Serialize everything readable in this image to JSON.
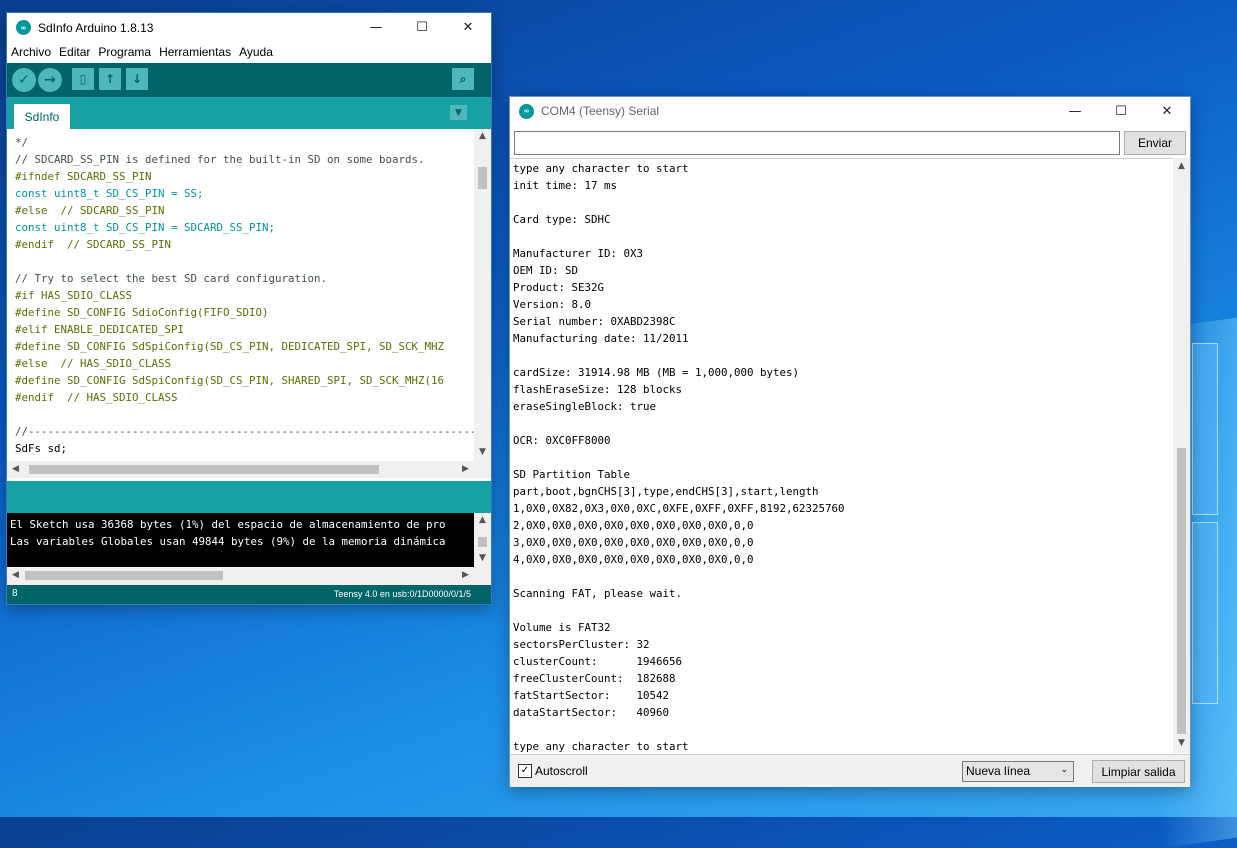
{
  "colors": {
    "arduino_dark": "#006468",
    "arduino_teal": "#17a1a5",
    "arduino_button": "#4db7bb",
    "console_bg": "#000000"
  },
  "ide": {
    "title": "SdInfo Arduino 1.8.13",
    "logo": "arduino-logo-icon",
    "menu": [
      "Archivo",
      "Editar",
      "Programa",
      "Herramientas",
      "Ayuda"
    ],
    "toolbar": {
      "verify": "verify-icon",
      "upload": "upload-icon",
      "new": "new-icon",
      "open": "open-icon",
      "save": "save-icon",
      "serial_monitor": "serial-monitor-icon"
    },
    "tab": "SdInfo",
    "code_lines": [
      {
        "text": "*/",
        "cls": "cm"
      },
      {
        "text": "// SDCARD_SS_PIN is defined for the built-in SD on some boards.",
        "cls": "cm"
      },
      {
        "text": "#ifndef SDCARD_SS_PIN",
        "cls": "kw"
      },
      {
        "text": "const uint8_t SD_CS_PIN = SS;",
        "cls": "ty"
      },
      {
        "text": "#else  // SDCARD_SS_PIN",
        "cls": "kw"
      },
      {
        "text": "const uint8_t SD_CS_PIN = SDCARD_SS_PIN;",
        "cls": "ty"
      },
      {
        "text": "#endif  // SDCARD_SS_PIN",
        "cls": "kw"
      },
      {
        "text": "",
        "cls": ""
      },
      {
        "text": "// Try to select the best SD card configuration.",
        "cls": "cm"
      },
      {
        "text": "#if HAS_SDIO_CLASS",
        "cls": "kw"
      },
      {
        "text": "#define SD_CONFIG SdioConfig(FIFO_SDIO)",
        "cls": "kw"
      },
      {
        "text": "#elif ENABLE_DEDICATED_SPI",
        "cls": "kw"
      },
      {
        "text": "#define SD_CONFIG SdSpiConfig(SD_CS_PIN, DEDICATED_SPI, SD_SCK_MHZ",
        "cls": "kw"
      },
      {
        "text": "#else  // HAS_SDIO_CLASS",
        "cls": "kw"
      },
      {
        "text": "#define SD_CONFIG SdSpiConfig(SD_CS_PIN, SHARED_SPI, SD_SCK_MHZ(16",
        "cls": "kw"
      },
      {
        "text": "#endif  // HAS_SDIO_CLASS",
        "cls": "kw"
      },
      {
        "text": "",
        "cls": ""
      },
      {
        "text": "//------------------------------------------------------------------------------",
        "cls": "cm"
      },
      {
        "text": "SdFs sd;",
        "cls": ""
      }
    ],
    "console_lines": [
      "El Sketch usa 36368 bytes (1%) del espacio de almacenamiento de pro",
      "Las variables Globales usan 49844 bytes (9%) de la memoria dinámica"
    ],
    "status_line": "8",
    "status_board": "Teensy 4.0 en usb:0/1D0000/0/1/5"
  },
  "serial": {
    "title": "COM4 (Teensy) Serial",
    "send_value": "",
    "send_label": "Enviar",
    "output_lines": [
      "type any character to start",
      "init time: 17 ms",
      "",
      "Card type: SDHC",
      "",
      "Manufacturer ID: 0X3",
      "OEM ID: SD",
      "Product: SE32G",
      "Version: 8.0",
      "Serial number: 0XABD2398C",
      "Manufacturing date: 11/2011",
      "",
      "cardSize: 31914.98 MB (MB = 1,000,000 bytes)",
      "flashEraseSize: 128 blocks",
      "eraseSingleBlock: true",
      "",
      "OCR: 0XC0FF8000",
      "",
      "SD Partition Table",
      "part,boot,bgnCHS[3],type,endCHS[3],start,length",
      "1,0X0,0X82,0X3,0X0,0XC,0XFE,0XFF,0XFF,8192,62325760",
      "2,0X0,0X0,0X0,0X0,0X0,0X0,0X0,0X0,0,0",
      "3,0X0,0X0,0X0,0X0,0X0,0X0,0X0,0X0,0,0",
      "4,0X0,0X0,0X0,0X0,0X0,0X0,0X0,0X0,0,0",
      "",
      "Scanning FAT, please wait.",
      "",
      "Volume is FAT32",
      "sectorsPerCluster: 32",
      "clusterCount:      1946656",
      "freeClusterCount:  182688",
      "fatStartSector:    10542",
      "dataStartSector:   40960",
      "",
      "type any character to start"
    ],
    "autoscroll_label": "Autoscroll",
    "autoscroll_checked": true,
    "line_ending": "Nueva línea",
    "clear_label": "Limpiar salida"
  }
}
